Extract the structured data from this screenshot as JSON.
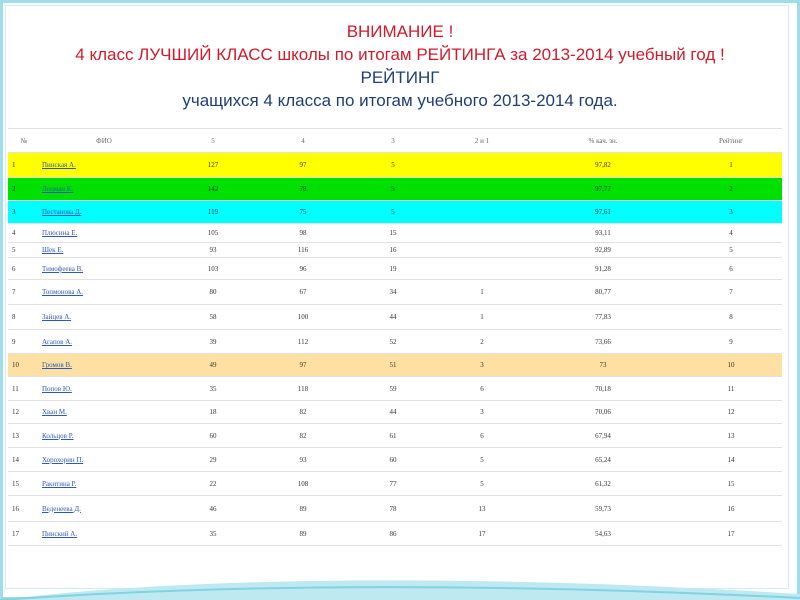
{
  "heading": {
    "line1": "ВНИМАНИЕ !",
    "line2": "4 класс ЛУЧШИЙ КЛАСС школы по итогам РЕЙТИНГА за 2013-2014 учебный год !",
    "line3": "РЕЙТИНГ",
    "line4": "учащихся 4 класса по итогам учебного 2013-2014 года."
  },
  "table": {
    "headers": [
      "№",
      "ФИО",
      "5",
      "4",
      "3",
      "2 и 1",
      "% кач. зн.",
      "Рейтинг"
    ],
    "rows": [
      {
        "no": "1",
        "name": "Пинская А.",
        "p5": "127",
        "p4": "97",
        "p3": "5",
        "p2": "",
        "quality": "97,82",
        "rank": "1",
        "highlight": "#ffff00"
      },
      {
        "no": "2",
        "name": "Лоцман К.",
        "p5": "142",
        "p4": "78",
        "p3": "5",
        "p2": "",
        "quality": "97,77",
        "rank": "2",
        "highlight": "#00e000"
      },
      {
        "no": "3",
        "name": "Пестанова Д.",
        "p5": "119",
        "p4": "75",
        "p3": "5",
        "p2": "",
        "quality": "97,61",
        "rank": "3",
        "highlight": "#00ffff"
      },
      {
        "no": "4",
        "name": "Плюсина Е.",
        "p5": "105",
        "p4": "98",
        "p3": "15",
        "p2": "",
        "quality": "93,11",
        "rank": "4",
        "highlight": ""
      },
      {
        "no": "5",
        "name": "Шек Е.",
        "p5": "93",
        "p4": "116",
        "p3": "16",
        "p2": "",
        "quality": "92,89",
        "rank": "5",
        "highlight": ""
      },
      {
        "no": "6",
        "name": "Тимофеева В.",
        "p5": "103",
        "p4": "96",
        "p3": "19",
        "p2": "",
        "quality": "91,28",
        "rank": "6",
        "highlight": ""
      },
      {
        "no": "7",
        "name": "Топмонова А.",
        "p5": "80",
        "p4": "67",
        "p3": "34",
        "p2": "1",
        "quality": "80,77",
        "rank": "7",
        "highlight": ""
      },
      {
        "no": "8",
        "name": "Зайцев А.",
        "p5": "58",
        "p4": "100",
        "p3": "44",
        "p2": "1",
        "quality": "77,83",
        "rank": "8",
        "highlight": ""
      },
      {
        "no": "9",
        "name": "Агапов А.",
        "p5": "39",
        "p4": "112",
        "p3": "52",
        "p2": "2",
        "quality": "73,66",
        "rank": "9",
        "highlight": ""
      },
      {
        "no": "10",
        "name": "Громов В.",
        "p5": "49",
        "p4": "97",
        "p3": "51",
        "p2": "3",
        "quality": "73",
        "rank": "10",
        "highlight": "#ffe0a3"
      },
      {
        "no": "11",
        "name": "Попов Ю.",
        "p5": "35",
        "p4": "118",
        "p3": "59",
        "p2": "6",
        "quality": "70,18",
        "rank": "11",
        "highlight": ""
      },
      {
        "no": "12",
        "name": "Хван М.",
        "p5": "18",
        "p4": "82",
        "p3": "44",
        "p2": "3",
        "quality": "70,06",
        "rank": "12",
        "highlight": ""
      },
      {
        "no": "13",
        "name": "Кольцов Р.",
        "p5": "60",
        "p4": "82",
        "p3": "61",
        "p2": "6",
        "quality": "67,94",
        "rank": "13",
        "highlight": ""
      },
      {
        "no": "14",
        "name": "Хорохорин П.",
        "p5": "29",
        "p4": "93",
        "p3": "60",
        "p2": "5",
        "quality": "65,24",
        "rank": "14",
        "highlight": ""
      },
      {
        "no": "15",
        "name": "Ракитина Р.",
        "p5": "22",
        "p4": "108",
        "p3": "77",
        "p2": "5",
        "quality": "61,32",
        "rank": "15",
        "highlight": ""
      },
      {
        "no": "16",
        "name": "Веденеева Д.",
        "p5": "46",
        "p4": "89",
        "p3": "78",
        "p2": "13",
        "quality": "59,73",
        "rank": "16",
        "highlight": ""
      },
      {
        "no": "17",
        "name": "Пинский А.",
        "p5": "35",
        "p4": "89",
        "p3": "86",
        "p2": "17",
        "quality": "54,63",
        "rank": "17",
        "highlight": ""
      }
    ]
  },
  "colors": {
    "title_red": "#d21a2b",
    "title_blue": "#1f3f73",
    "frame": "#9fdde8",
    "link": "#2e59b8"
  }
}
